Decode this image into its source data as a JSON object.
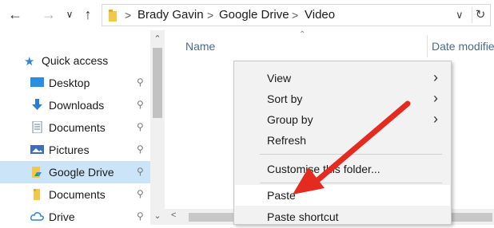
{
  "nav": {
    "back_icon": "arrow-left-icon",
    "forward_icon": "arrow-right-icon",
    "recent_icon": "chevron-down-icon",
    "up_icon": "arrow-up-icon"
  },
  "address": {
    "crumbs": [
      "Brady Gavin",
      "Google Drive",
      "Video"
    ],
    "separator": ">",
    "dropdown_glyph": "∨",
    "refresh_glyph": "↻"
  },
  "sidebar": {
    "quick_access": "Quick access",
    "items": [
      {
        "label": "Desktop",
        "icon": "desktop-icon"
      },
      {
        "label": "Downloads",
        "icon": "download-icon"
      },
      {
        "label": "Documents",
        "icon": "documents-icon"
      },
      {
        "label": "Pictures",
        "icon": "pictures-icon"
      },
      {
        "label": "Google Drive",
        "icon": "google-drive-folder-icon",
        "selected": true
      },
      {
        "label": "Documents",
        "icon": "folder-icon"
      },
      {
        "label": "Drive",
        "icon": "cloud-icon"
      }
    ],
    "pin_glyph": "📌"
  },
  "columns": {
    "name": "Name",
    "date": "Date modifie"
  },
  "context_menu": {
    "items": [
      {
        "label": "View",
        "submenu": true
      },
      {
        "label": "Sort by",
        "submenu": true
      },
      {
        "label": "Group by",
        "submenu": true
      },
      {
        "label": "Refresh",
        "submenu": false
      },
      {
        "label": "Customise this folder...",
        "submenu": false
      },
      {
        "label": "Paste",
        "submenu": false,
        "highlighted": true
      },
      {
        "label": "Paste shortcut",
        "submenu": false
      }
    ]
  },
  "colors": {
    "selected_bg": "#cce4f7",
    "annotation": "#e52b1f",
    "menu_bg": "#f2f2f2"
  }
}
